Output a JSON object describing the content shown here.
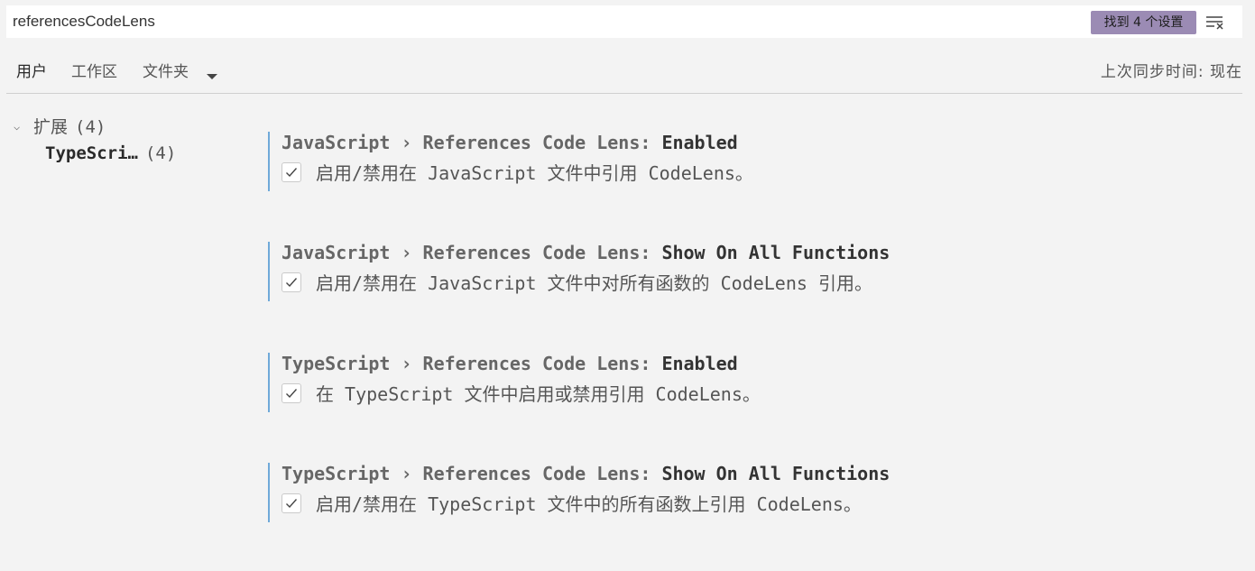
{
  "search": {
    "value": "referencesCodeLens",
    "result_badge": "找到  4  个设置",
    "clear_icon": "clear-filter-icon"
  },
  "scope_tabs": {
    "user": "用户",
    "workspace": "工作区",
    "folder": "文件夹",
    "folder_icon": "chevron-down-icon",
    "sync_status": "上次同步时间: 现在"
  },
  "toc": {
    "extensions_label": "扩展",
    "extensions_count": "(4)",
    "typescript_label": "TypeScri…",
    "typescript_count": "(4)"
  },
  "settings": [
    {
      "category": "JavaScript › References Code Lens: ",
      "name": "Enabled",
      "description": "启用/禁用在 JavaScript 文件中引用 CodeLens。",
      "checked": true
    },
    {
      "category": "JavaScript › References Code Lens: ",
      "name": "Show On All Functions",
      "description": "启用/禁用在 JavaScript 文件中对所有函数的 CodeLens 引用。",
      "checked": true
    },
    {
      "category": "TypeScript › References Code Lens: ",
      "name": "Enabled",
      "description": "在 TypeScript 文件中启用或禁用引用 CodeLens。",
      "checked": true
    },
    {
      "category": "TypeScript › References Code Lens: ",
      "name": "Show On All Functions",
      "description": "启用/禁用在 TypeScript 文件中的所有函数上引用 CodeLens。",
      "checked": true
    }
  ],
  "colors": {
    "badge": "#9b8bb4",
    "modified_indicator": "#6fa9d9",
    "background": "#f3f3f3"
  }
}
